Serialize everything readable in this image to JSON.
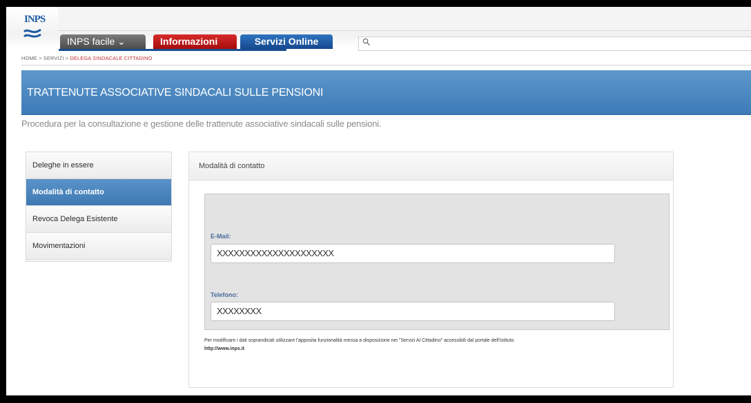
{
  "header": {
    "logo_text": "INPS",
    "tabs": [
      {
        "label": "INPS facile ⌄"
      },
      {
        "label": "Informazioni"
      },
      {
        "label": "Servizi Online"
      }
    ],
    "search": {
      "icon": "search-icon",
      "value": ""
    }
  },
  "breadcrumb": {
    "home": "HOME",
    "sep1": " > ",
    "servizi": "SERVIZI",
    "sep2": " > ",
    "current": "DELEGA SINDACALE CITTADINO"
  },
  "banner": {
    "title": "TRATTENUTE ASSOCIATIVE SINDACALI SULLE PENSIONI"
  },
  "subtitle": "Procedura per la consultazione e gestione delle trattenute associative sindacali sulle pensioni.",
  "sidebar": {
    "items": [
      {
        "label": "Deleghe in essere"
      },
      {
        "label": "Modalità di contatto"
      },
      {
        "label": "Revoca Delega Esistente"
      },
      {
        "label": "Movimentazioni"
      }
    ]
  },
  "panel": {
    "header": "Modalità di contatto",
    "email": {
      "label": "E-Mail:",
      "value": "XXXXXXXXXXXXXXXXXXXXX"
    },
    "telefono": {
      "label": "Telefono:",
      "value": "XXXXXXXX"
    },
    "note": "Per modificare i dati soprandicati utilizzare l'apposita funzionalità messa a disposizione nei \"Servizi Al Cittadino\" accessibili dal portale dell'Istituto",
    "note_url": "http://www.inps.it"
  },
  "colors": {
    "brand_blue": "#3d7bb7",
    "info_red": "#a50d0d",
    "servizi_blue": "#15488e",
    "breadcrumb_active": "#c23232"
  }
}
